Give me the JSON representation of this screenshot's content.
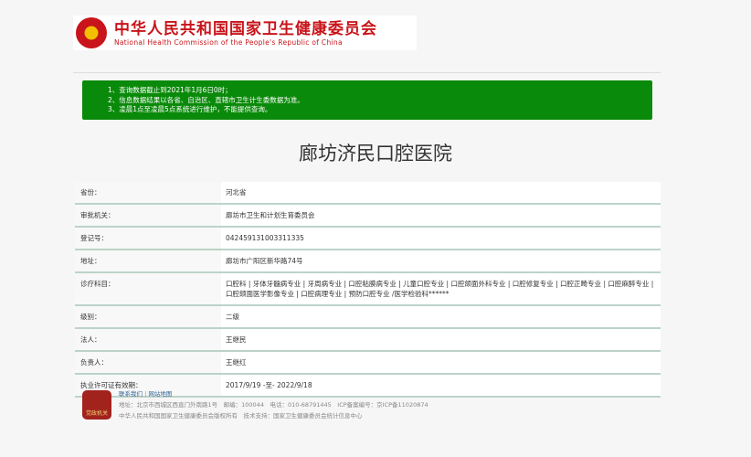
{
  "header": {
    "title_cn": "中华人民共和国国家卫生健康委员会",
    "title_en": "National Health Commission of the People's Republic of China"
  },
  "notice": [
    "1、查询数据截止到2021年1月6日0时；",
    "2、信息数据结果以各省、自治区、直辖市卫生计生委数据为准。",
    "3、凌晨1点至凌晨5点系统进行维护，不能提供查询。"
  ],
  "page_title": "廊坊济民口腔医院",
  "rows": [
    {
      "label": "省份：",
      "value": "河北省"
    },
    {
      "label": "审批机关：",
      "value": "廊坊市卫生和计划生育委员会"
    },
    {
      "label": "登记号：",
      "value": "042459131003311335"
    },
    {
      "label": "地址：",
      "value": "廊坊市广阳区新华路74号"
    },
    {
      "label": "诊疗科目：",
      "value": "口腔科 | 牙体牙髓病专业 | 牙周病专业 | 口腔粘膜病专业 | 儿童口腔专业 | 口腔颌面外科专业 | 口腔修复专业 | 口腔正畸专业 | 口腔麻醉专业 | 口腔颌面医学影像专业 | 口腔病理专业 | 预防口腔专业 /医学检验科******"
    },
    {
      "label": "级别：",
      "value": "二级"
    },
    {
      "label": "法人：",
      "value": "王继民"
    },
    {
      "label": "负责人：",
      "value": "王继红"
    },
    {
      "label": "执业许可证有效期：",
      "value": "2017/9/19 -至- 2022/9/18"
    }
  ],
  "footer": {
    "contact": "联系我们",
    "sep": "|",
    "sitemap": "网站地图",
    "address": "地址：北京市西城区西直门外南路1号　邮编：100044　电话：010-68791445　ICP备案编号：京ICP备11020874",
    "copyright": "中华人民共和国国家卫生健康委员会版权所有　技术支持：国家卫生健康委员会统计信息中心",
    "badge": "党政机关"
  }
}
